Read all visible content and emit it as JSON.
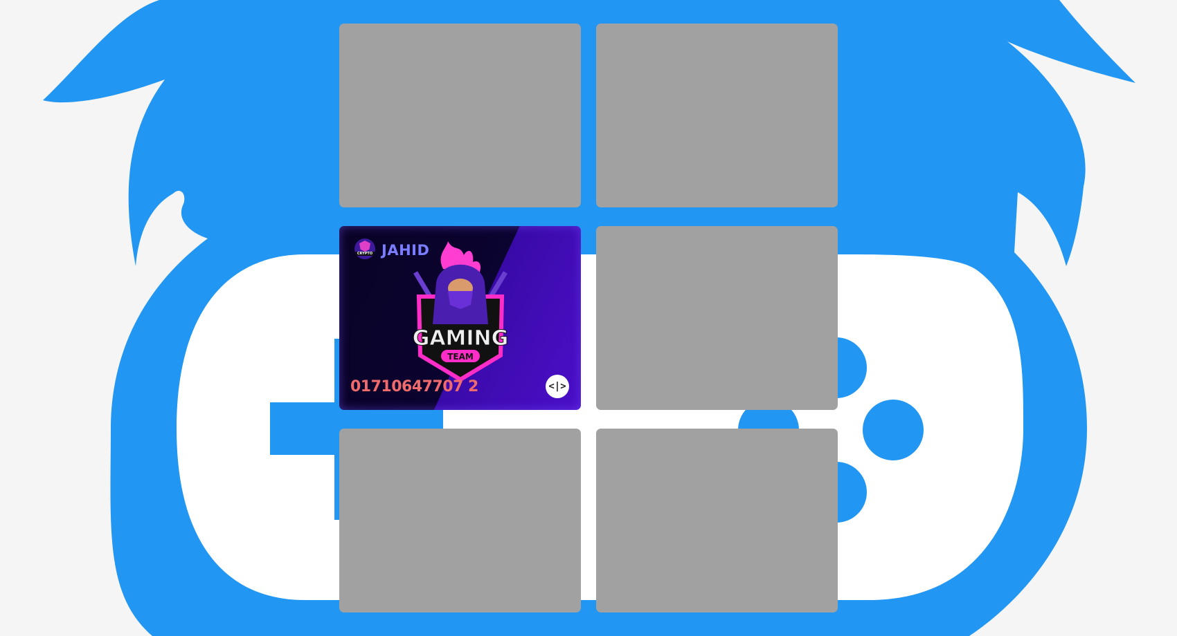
{
  "board": {
    "cards": [
      {
        "state": "hidden"
      },
      {
        "state": "hidden"
      },
      {
        "state": "revealed",
        "name": "JAHID",
        "phone": "01710647707 2",
        "logo_title": "GAMING",
        "logo_subtitle": "TEAM",
        "badge_text": "CRYPTO"
      },
      {
        "state": "hidden"
      },
      {
        "state": "hidden"
      },
      {
        "state": "hidden"
      }
    ]
  },
  "colors": {
    "background": "#f5f5f5",
    "mascot_blue": "#2196f3",
    "card_back": "#a1a1a1",
    "accent_pink": "#ff2dc8"
  }
}
